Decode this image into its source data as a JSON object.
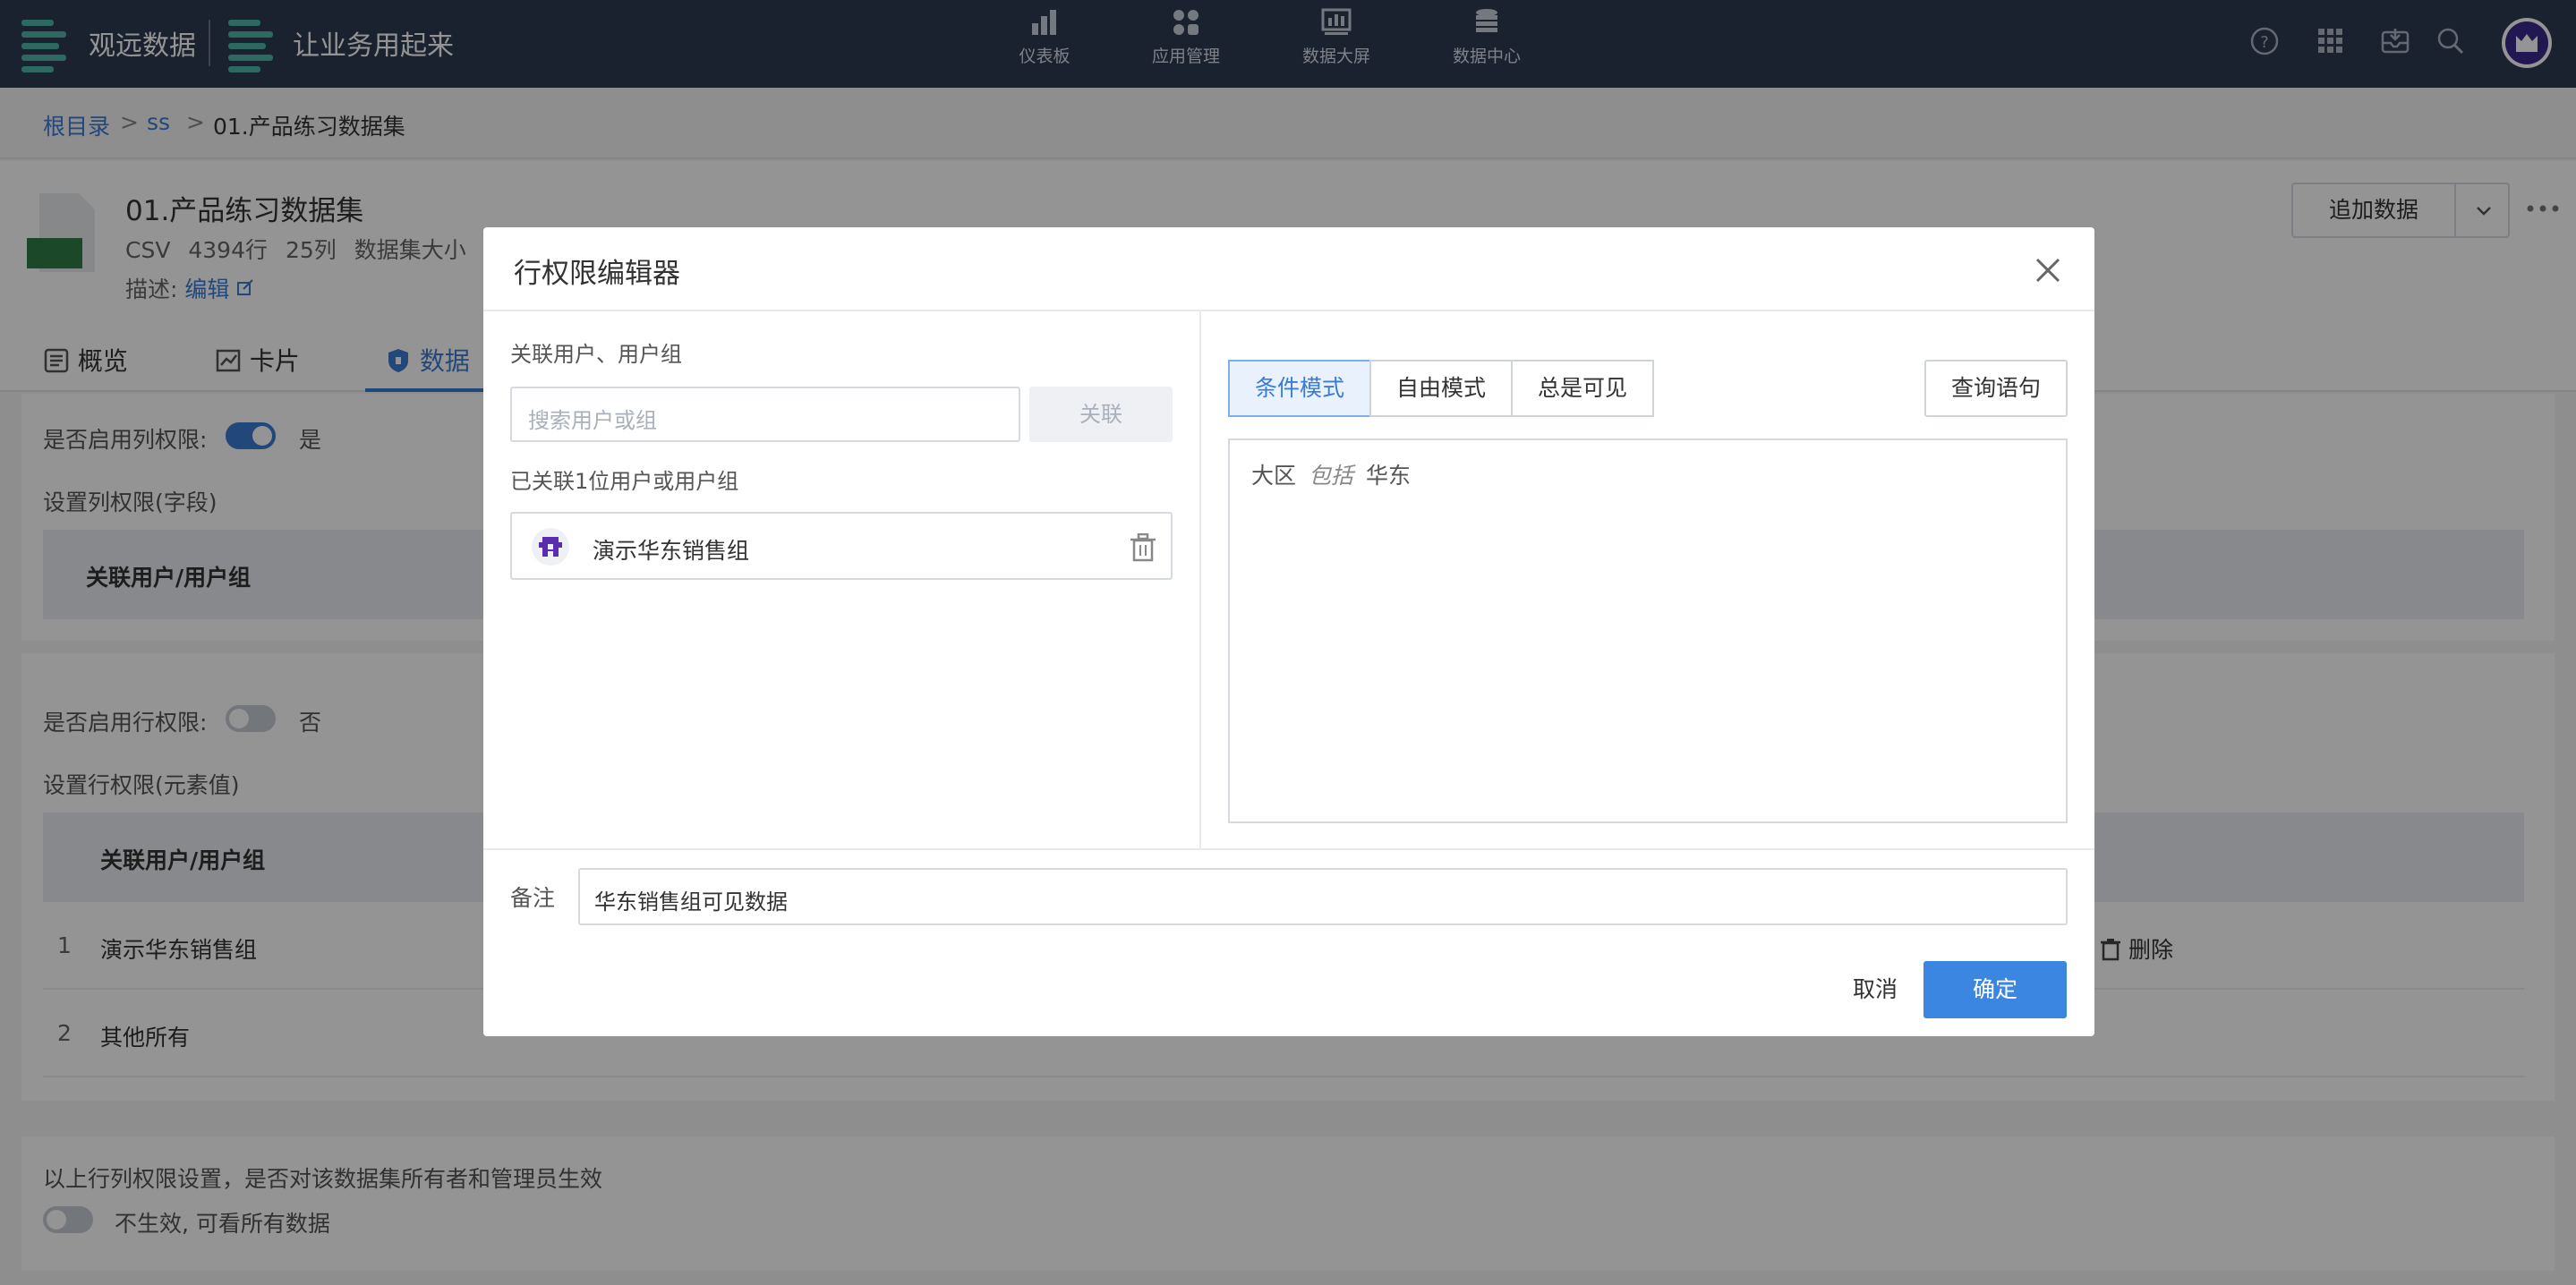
{
  "topbar": {
    "brand": "观远数据",
    "app_name": "让业务用起来",
    "nav": [
      {
        "label": "仪表板",
        "icon": "bar-chart-icon"
      },
      {
        "label": "应用管理",
        "icon": "apps-icon"
      },
      {
        "label": "数据大屏",
        "icon": "big-screen-icon"
      },
      {
        "label": "数据中心",
        "icon": "database-icon"
      }
    ],
    "right_icons": [
      "help-icon",
      "grid-icon",
      "inbox-icon",
      "search-icon",
      "avatar"
    ]
  },
  "breadcrumb": {
    "root": "根目录",
    "sep": ">",
    "folder": "ss",
    "current": "01.产品练习数据集"
  },
  "dataset": {
    "icon_label": "CSV",
    "title": "01.产品练习数据集",
    "meta": "CSV   4394行   25列   数据集大小",
    "desc_label": "描述:",
    "desc_edit": "编辑",
    "add_data_button": "追加数据",
    "tabs": [
      {
        "label": "概览"
      },
      {
        "label": "卡片"
      },
      {
        "label": "数据"
      }
    ]
  },
  "column_permission": {
    "enable_label": "是否启用列权限:",
    "enabled_text": "是",
    "section_label": "设置列权限(字段)",
    "header_user": "关联用户/用户组"
  },
  "row_permission": {
    "enable_label": "是否启用行权限:",
    "enabled_text": "否",
    "section_label": "设置行权限(元素值)",
    "header_user": "关联用户/用户组",
    "rows": [
      {
        "idx": "1",
        "name": "演示华东销售组",
        "action": "删除"
      },
      {
        "idx": "2",
        "name": "其他所有"
      }
    ]
  },
  "owner_setting": {
    "label": "以上行列权限设置，是否对该数据集所有者和管理员生效",
    "toggle_text": "不生效, 可看所有数据"
  },
  "modal": {
    "title": "行权限编辑器",
    "assoc_label": "关联用户、用户组",
    "search_placeholder": "搜索用户或组",
    "link_button": "关联",
    "linked_count_label": "已关联1位用户或用户组",
    "linked_user": "演示华东销售组",
    "modes": [
      "条件模式",
      "自由模式",
      "总是可见"
    ],
    "active_mode": "条件模式",
    "query_button": "查询语句",
    "condition": {
      "field": "大区",
      "op": "包括",
      "value": "华东"
    },
    "remark_label": "备注",
    "remark_value": "华东销售组可见数据",
    "cancel_button": "取消",
    "ok_button": "确定"
  },
  "colors": {
    "topbar_bg": "#2e3a52",
    "primary": "#3a86e0",
    "link": "#3a7bd5"
  }
}
